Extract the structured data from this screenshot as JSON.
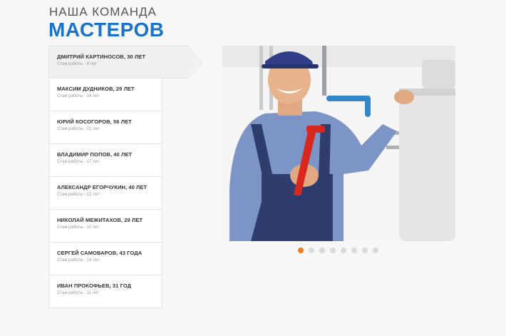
{
  "header": {
    "subtitle": "НАША КОМАНДА",
    "title": "МАСТЕРОВ"
  },
  "masters": [
    {
      "name": "ДМИТРИЙ КАРТИНОСОВ, 30 ЛЕТ",
      "experience": "Стаж работы - 8 лет",
      "active": true
    },
    {
      "name": "МАКСИМ ДУДНИКОВ, 29 ЛЕТ",
      "experience": "Стаж работы - 16 лет",
      "active": false
    },
    {
      "name": "ЮРИЙ КОСОГОРОВ, 56 ЛЕТ",
      "experience": "Стаж работы - 21 лет",
      "active": false
    },
    {
      "name": "ВЛАДИМИР ПОПОВ, 40 ЛЕТ",
      "experience": "Стаж работы - 17 лет",
      "active": false
    },
    {
      "name": "АЛЕКСАНДР ЕГОРЧУКИН, 40 ЛЕТ",
      "experience": "Стаж работы - 12 лет",
      "active": false
    },
    {
      "name": "НИКОЛАЙ МЕЖИТАХОВ, 29 ЛЕТ",
      "experience": "Стаж работы - 10 лет",
      "active": false
    },
    {
      "name": "СЕРГЕЙ САМОВАРОВ, 43 ГОДА",
      "experience": "Стаж работы - 14 лет",
      "active": false
    },
    {
      "name": "ИВАН ПРОКОФЬЕВ, 31 ГОД",
      "experience": "Стаж работы - 11 лет",
      "active": false
    }
  ],
  "slider": {
    "dot_count": 8,
    "active_index": 0
  },
  "colors": {
    "title": "#1a73c9",
    "active_dot": "#f07d1e",
    "overalls": "#2e3d6e",
    "shirt": "#7d95c6",
    "wrench": "#d8281e"
  }
}
